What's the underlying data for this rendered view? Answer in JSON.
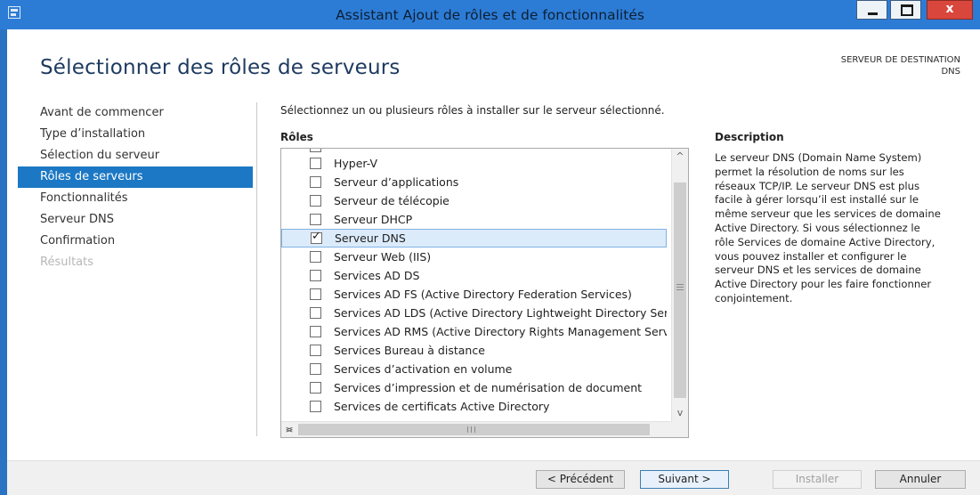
{
  "window": {
    "title": "Assistant Ajout de rôles et de fonctionnalités",
    "close_glyph": "x"
  },
  "header": {
    "heading": "Sélectionner des rôles de serveurs",
    "destination_label": "SERVEUR DE DESTINATION",
    "destination_value": "DNS"
  },
  "nav": {
    "items": [
      {
        "label": "Avant de commencer",
        "state": "normal"
      },
      {
        "label": "Type d’installation",
        "state": "normal"
      },
      {
        "label": "Sélection du serveur",
        "state": "normal"
      },
      {
        "label": "Rôles de serveurs",
        "state": "active"
      },
      {
        "label": "Fonctionnalités",
        "state": "normal"
      },
      {
        "label": "Serveur DNS",
        "state": "normal"
      },
      {
        "label": "Confirmation",
        "state": "normal"
      },
      {
        "label": "Résultats",
        "state": "disabled"
      }
    ]
  },
  "main": {
    "instruction": "Sélectionnez un ou plusieurs rôles à installer sur le serveur sélectionné.",
    "roles_title": "Rôles",
    "roles": [
      {
        "label": "Hyper-V",
        "checked": false
      },
      {
        "label": "Serveur d’applications",
        "checked": false
      },
      {
        "label": "Serveur de télécopie",
        "checked": false
      },
      {
        "label": "Serveur DHCP",
        "checked": false
      },
      {
        "label": "Serveur DNS",
        "checked": true,
        "selected": true
      },
      {
        "label": "Serveur Web (IIS)",
        "checked": false
      },
      {
        "label": "Services AD DS",
        "checked": false
      },
      {
        "label": "Services AD FS (Active Directory Federation Services)",
        "checked": false
      },
      {
        "label": "Services AD LDS (Active Directory Lightweight Directory Services)",
        "checked": false
      },
      {
        "label": "Services AD RMS (Active Directory Rights Management Services)",
        "checked": false
      },
      {
        "label": "Services Bureau à distance",
        "checked": false
      },
      {
        "label": "Services d’activation en volume",
        "checked": false
      },
      {
        "label": "Services d’impression et de numérisation de document",
        "checked": false
      },
      {
        "label": "Services de certificats Active Directory",
        "checked": false
      }
    ],
    "check_glyph": "✓",
    "scroll": {
      "up": "^",
      "down": "v",
      "left": "<",
      "right": ">"
    },
    "description_title": "Description",
    "description_text": "Le serveur DNS (Domain Name System) permet la résolution de noms sur les réseaux TCP/IP. Le serveur DNS est plus facile à gérer lorsqu’il est installé sur le même serveur que les services de domaine Active Directory. Si vous sélectionnez le rôle Services de domaine Active Directory, vous pouvez installer et configurer le serveur DNS et les services de domaine Active Directory pour les faire fonctionner conjointement."
  },
  "footer": {
    "previous_label": "< Précédent",
    "next_label": "Suivant >",
    "install_label": "Installer",
    "cancel_label": "Annuler"
  },
  "colors": {
    "accent": "#1c78c4",
    "titlebar": "#2c7cd6",
    "close": "#d9463c"
  }
}
